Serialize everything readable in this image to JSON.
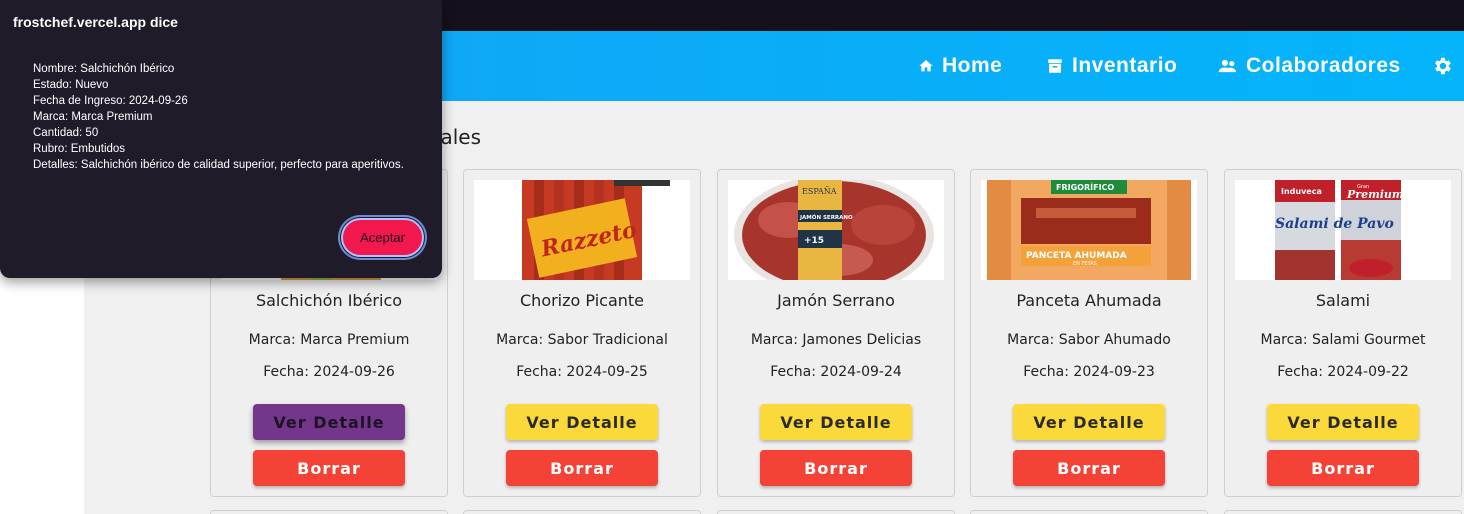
{
  "nav": {
    "home": "Home",
    "inventario": "Inventario",
    "colaboradores": "Colaboradores"
  },
  "section": {
    "title_partial": "orales"
  },
  "cards": [
    {
      "name": "Salchichón Ibérico",
      "brand": "Marca: Marca Premium",
      "date": "Fecha: 2024-09-26",
      "detail": "Ver Detalle",
      "delete": "Borrar"
    },
    {
      "name": "Chorizo Picante",
      "brand": "Marca: Sabor Tradicional",
      "date": "Fecha: 2024-09-25",
      "detail": "Ver Detalle",
      "delete": "Borrar"
    },
    {
      "name": "Jamón Serrano",
      "brand": "Marca: Jamones Delicias",
      "date": "Fecha: 2024-09-24",
      "detail": "Ver Detalle",
      "delete": "Borrar"
    },
    {
      "name": "Panceta Ahumada",
      "brand": "Marca: Sabor Ahumado",
      "date": "Fecha: 2024-09-23",
      "detail": "Ver Detalle",
      "delete": "Borrar"
    },
    {
      "name": "Salami",
      "brand": "Marca: Salami Gourmet",
      "date": "Fecha: 2024-09-22",
      "detail": "Ver Detalle",
      "delete": "Borrar"
    }
  ],
  "product_images": {
    "chorizo": "Razzeto",
    "jamon_brand": "ESPAÑA",
    "jamon_label": "JAMÓN SERRANO",
    "jamon_badge": "+15",
    "panceta_brand": "FRIGORÍFICO",
    "panceta_label": "PANCETA AHUMADA",
    "panceta_sub": "EN FETAS",
    "salami_brand": "Induveca",
    "salami_label": "Salami de Pavo",
    "salami_top": "Premium",
    "salami_top_small": "Gran"
  },
  "dialog": {
    "title": "frostchef.vercel.app dice",
    "lines": [
      "Nombre: Salchichón Ibérico",
      "Estado: Nuevo",
      "Fecha de Ingreso: 2024-09-26",
      "Marca: Marca Premium",
      "Cantidad: 50",
      "Rubro: Embutidos",
      "Detalles: Salchichón ibérico de calidad superior, perfecto para aperitivos."
    ],
    "ok": "Aceptar"
  },
  "colors": {
    "nav_start": "#12a3f5",
    "nav_end": "#04b4fb",
    "detail_button": "#fcd93a",
    "detail_active": "#74368a",
    "delete_button": "#f44336",
    "dialog_bg": "#1f1b29",
    "dialog_ok": "#f2184e"
  }
}
